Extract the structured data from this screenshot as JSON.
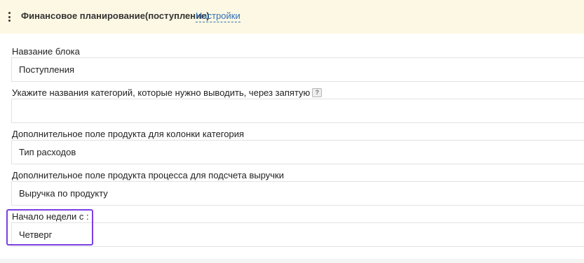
{
  "header": {
    "title": "Финансовое планирование(поступление)",
    "settings_link": "Настройки"
  },
  "fields": {
    "block_name": {
      "label": "Навзание блока",
      "value": "Поступления"
    },
    "categories": {
      "label": "Укажите названия категорий, которые нужно выводить, через запятую",
      "help_glyph": "?",
      "value": ""
    },
    "category_column": {
      "label": "Дополнительное поле продукта для колонки категория",
      "value": "Тип расходов"
    },
    "revenue_field": {
      "label": "Дополнительное поле продукта процесса для подсчета выручки",
      "value": "Выручка по продукту"
    },
    "week_start": {
      "label": "Начало недели с :",
      "value": "Четверг"
    }
  },
  "colors": {
    "header_bg": "#fdf8e3",
    "link": "#2f6fb7",
    "highlight": "#7b3fe4",
    "input_border": "#e2e2e2"
  }
}
